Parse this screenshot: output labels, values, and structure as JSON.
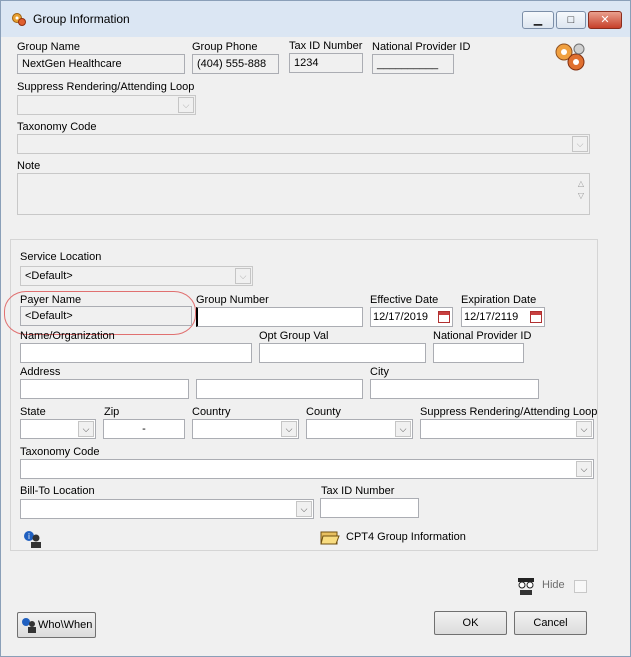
{
  "window": {
    "title": "Group Information"
  },
  "group": {
    "name_label": "Group Name",
    "name_value": "NextGen Healthcare",
    "phone_label": "Group Phone",
    "phone_value": "(404) 555-888",
    "taxid_label": "Tax ID Number",
    "taxid_value": "1234",
    "npi_label": "National Provider ID",
    "npi_value": "__________",
    "suppress_label": "Suppress Rendering/Attending Loop",
    "taxonomy_label": "Taxonomy Code",
    "note_label": "Note"
  },
  "payer": {
    "service_location_label": "Service Location",
    "service_location_value": "<Default>",
    "payer_name_label": "Payer Name",
    "payer_name_value": "<Default>",
    "group_number_label": "Group Number",
    "effective_date_label": "Effective Date",
    "effective_date_value": "12/17/2019",
    "expiration_date_label": "Expiration Date",
    "expiration_date_value": "12/17/2119",
    "name_org_label": "Name/Organization",
    "opt_group_label": "Opt Group Val",
    "npi_label": "National Provider ID",
    "address_label": "Address",
    "city_label": "City",
    "state_label": "State",
    "zip_label": "Zip",
    "zip_value": "-",
    "country_label": "Country",
    "county_label": "County",
    "suppress_label": "Suppress Rendering/Attending Loop",
    "taxonomy_label": "Taxonomy Code",
    "bill_to_label": "Bill-To Location",
    "taxid_label": "Tax ID Number",
    "cpt4_label": "CPT4 Group Information"
  },
  "footer": {
    "hide_label": "Hide",
    "who_when_label": "Who\\When",
    "ok_label": "OK",
    "cancel_label": "Cancel"
  },
  "colors": {
    "titlebar": "#dbe6f3",
    "close_button": "#c7402a",
    "highlight": "#e07070"
  }
}
